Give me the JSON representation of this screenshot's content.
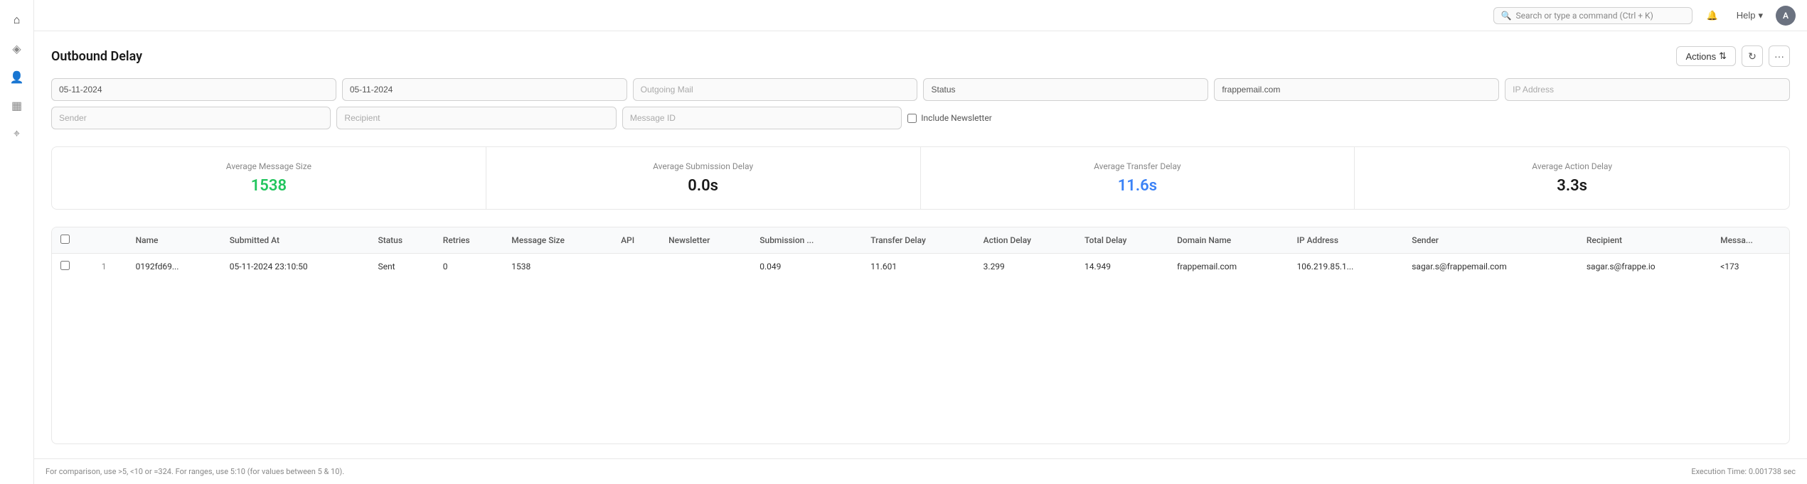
{
  "sidebar": {
    "icons": [
      {
        "name": "home-icon",
        "glyph": "⌂"
      },
      {
        "name": "chart-icon",
        "glyph": "◈"
      },
      {
        "name": "users-icon",
        "glyph": "👤"
      },
      {
        "name": "calendar-icon",
        "glyph": "▦"
      },
      {
        "name": "tag-icon",
        "glyph": "⌖"
      }
    ]
  },
  "topbar": {
    "search_placeholder": "Search or type a command (Ctrl + K)",
    "help_label": "Help",
    "avatar_label": "A",
    "bell_icon": "🔔"
  },
  "page": {
    "title": "Outbound Delay",
    "actions_label": "Actions"
  },
  "filters": {
    "date_from": "05-11-2024",
    "date_to": "05-11-2024",
    "mail_type_placeholder": "Outgoing Mail",
    "status_placeholder": "Status",
    "domain": "frappemail.com",
    "ip_placeholder": "IP Address",
    "sender_placeholder": "Sender",
    "recipient_placeholder": "Recipient",
    "message_id_placeholder": "Message ID",
    "include_newsletter_label": "Include Newsletter"
  },
  "stats": {
    "avg_message_size": {
      "label": "Average Message Size",
      "value": "1538",
      "color": "green"
    },
    "avg_submission_delay": {
      "label": "Average Submission Delay",
      "value": "0.0s",
      "color": "normal"
    },
    "avg_transfer_delay": {
      "label": "Average Transfer Delay",
      "value": "11.6s",
      "color": "blue"
    },
    "avg_action_delay": {
      "label": "Average Action Delay",
      "value": "3.3s",
      "color": "normal"
    }
  },
  "table": {
    "columns": [
      {
        "key": "row_num",
        "label": ""
      },
      {
        "key": "name",
        "label": "Name"
      },
      {
        "key": "submitted_at",
        "label": "Submitted At"
      },
      {
        "key": "status",
        "label": "Status"
      },
      {
        "key": "retries",
        "label": "Retries"
      },
      {
        "key": "message_size",
        "label": "Message Size"
      },
      {
        "key": "api",
        "label": "API"
      },
      {
        "key": "newsletter",
        "label": "Newsletter"
      },
      {
        "key": "submission_delay",
        "label": "Submission ..."
      },
      {
        "key": "transfer_delay",
        "label": "Transfer Delay"
      },
      {
        "key": "action_delay",
        "label": "Action Delay"
      },
      {
        "key": "total_delay",
        "label": "Total Delay"
      },
      {
        "key": "domain_name",
        "label": "Domain Name"
      },
      {
        "key": "ip_address",
        "label": "IP Address"
      },
      {
        "key": "sender",
        "label": "Sender"
      },
      {
        "key": "recipient",
        "label": "Recipient"
      },
      {
        "key": "message",
        "label": "Messa..."
      }
    ],
    "rows": [
      {
        "row_num": "1",
        "name": "0192fd69...",
        "submitted_at": "05-11-2024 23:10:50",
        "status": "Sent",
        "retries": "0",
        "message_size": "1538",
        "api": "",
        "newsletter": "",
        "submission_delay": "0.049",
        "transfer_delay": "11.601",
        "action_delay": "3.299",
        "total_delay": "14.949",
        "domain_name": "frappemail.com",
        "ip_address": "106.219.85.1...",
        "sender": "sagar.s@frappemail.com",
        "recipient": "sagar.s@frappe.io",
        "message": "<173"
      }
    ]
  },
  "footer": {
    "help_text": "For comparison, use >5, <10 or =324. For ranges, use 5:10 (for values between 5 & 10).",
    "execution_time": "Execution Time: 0.001738 sec"
  }
}
